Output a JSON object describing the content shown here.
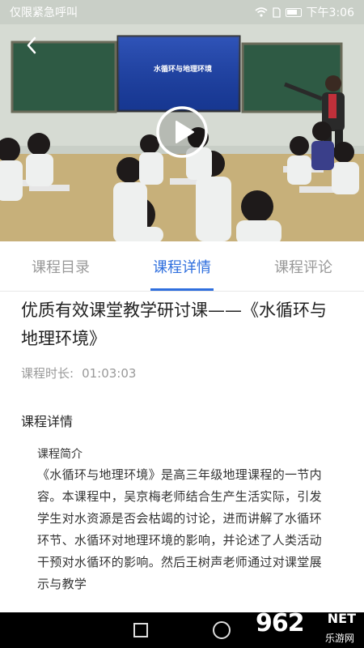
{
  "status_bar": {
    "carrier_text": "仅限紧急呼叫",
    "time": "下午3:06",
    "icons": [
      "wifi-icon",
      "sim-icon",
      "battery-icon"
    ]
  },
  "video": {
    "slide_text": "水循环与地理环境",
    "back_icon": "chevron-left-icon",
    "play_icon": "play-icon"
  },
  "tabs": [
    {
      "label": "课程目录",
      "active": false
    },
    {
      "label": "课程详情",
      "active": true
    },
    {
      "label": "课程评论",
      "active": false
    }
  ],
  "course": {
    "title": "优质有效课堂教学研讨课——《水循环与地理环境》",
    "duration_label": "课程时长:",
    "duration_value": "01:03:03",
    "details_heading": "课程详情",
    "intro_heading": "课程简介",
    "intro_body": "《水循环与地理环境》是高三年级地理课程的一节内容。本课程中，吴京梅老师结合生产生活实际，引发学生对水资源是否会枯竭的讨论，进而讲解了水循环环节、水循环对地理环境的影响，并论述了人类活动干预对水循环的影响。然后王树声老师通过对课堂展示与教学"
  },
  "navbar": {
    "icons": [
      "recent-apps-icon",
      "home-icon"
    ]
  },
  "watermark": {
    "number": "962",
    "net": "NET",
    "site": "乐游网"
  },
  "colors": {
    "accent": "#2f6fde",
    "muted": "#999999"
  }
}
